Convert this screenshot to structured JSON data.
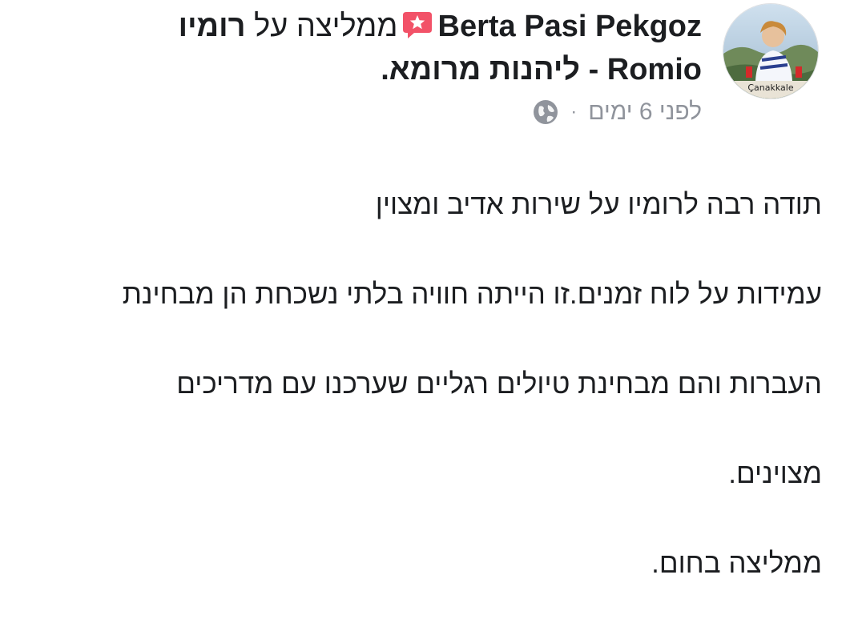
{
  "review": {
    "reviewer_name": "Berta Pasi Pekgoz",
    "recommends_text": "ממליצה על",
    "page_name": "רומיו",
    "page_name_rest": "Romio - ליהנות מרומא",
    "header_end": ".",
    "timestamp": "לפני 6 ימים",
    "separator": "·",
    "privacy_icon": "globe-icon",
    "recommend_icon": "recommend-star-bubble-icon",
    "recommend_icon_color": "#f25268",
    "avatar_caption": "Çanakkale",
    "body_lines": [
      "תודה רבה לרומיו על שירות אדיב ומצוין",
      "עמידות על לוח זמנים.זו הייתה חוויה בלתי נשכחת  הן מבחינת",
      "העברות והם מבחינת טיולים רגליים שערכנו עם מדריכים",
      "מצוינים.",
      "ממליצה בחום."
    ]
  }
}
